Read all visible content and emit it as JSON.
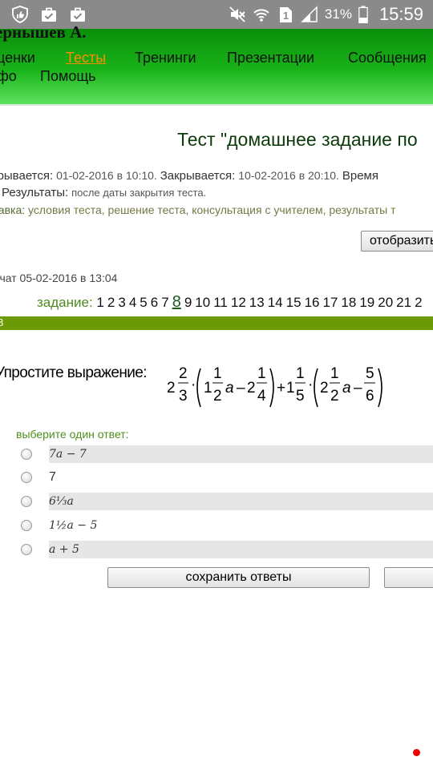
{
  "status_bar": {
    "battery_percent": "31%",
    "time": "15:59",
    "sim_slot": "1",
    "icons": [
      "thumb-up-shield-icon",
      "briefcase-check-icon",
      "briefcase-check-icon",
      "mute-icon",
      "wifi-icon",
      "sim-icon",
      "signal-icon",
      "battery-icon"
    ]
  },
  "header": {
    "user_name": "ернышев А.",
    "nav": [
      {
        "label": "ценки",
        "active": false
      },
      {
        "label": "Тесты",
        "active": true
      },
      {
        "label": "Тренинги",
        "active": false
      },
      {
        "label": "Презентации",
        "active": false
      },
      {
        "label": "Сообщения",
        "active": false
      },
      {
        "label": "фо",
        "active": false
      },
      {
        "label": "Помощь",
        "active": false
      }
    ]
  },
  "test": {
    "title": "Тест \"домашнее задание по",
    "opens_label": "крывается:",
    "opens_value": "01-02-2016 в 10:10.",
    "closes_label": "Закрывается:",
    "closes_value": "10-02-2016 в 20:10.",
    "time_label": "Время",
    "results_label": "Результаты:",
    "results_value": "после даты закрытия теста.",
    "help_label": "равка:",
    "help_value": "условия теста, решение теста, консультация с учителем, результаты т",
    "show_button": "отобразить",
    "started": "ачат 05-02-2016 в 13:04"
  },
  "tasks": {
    "label": "задание:",
    "numbers": [
      "1",
      "2",
      "3",
      "4",
      "5",
      "6",
      "7",
      "8",
      "9",
      "10",
      "11",
      "12",
      "13",
      "14",
      "15",
      "16",
      "17",
      "18",
      "19",
      "20",
      "21",
      "2"
    ],
    "current": "8"
  },
  "bar_text": "8",
  "question": {
    "text": "Упростите выражение:",
    "formula": "2 2/3 · (1 1/2 a − 2 1/4) + 1 1/5 · (2 1/2 a − 5/6)"
  },
  "answers": {
    "prompt": "выберите один ответ:",
    "options": [
      "7a − 7",
      "7",
      "6⅓a",
      "1½a − 5",
      "a + 5"
    ]
  },
  "buttons": {
    "save": "сохранить ответы",
    "second": ""
  }
}
